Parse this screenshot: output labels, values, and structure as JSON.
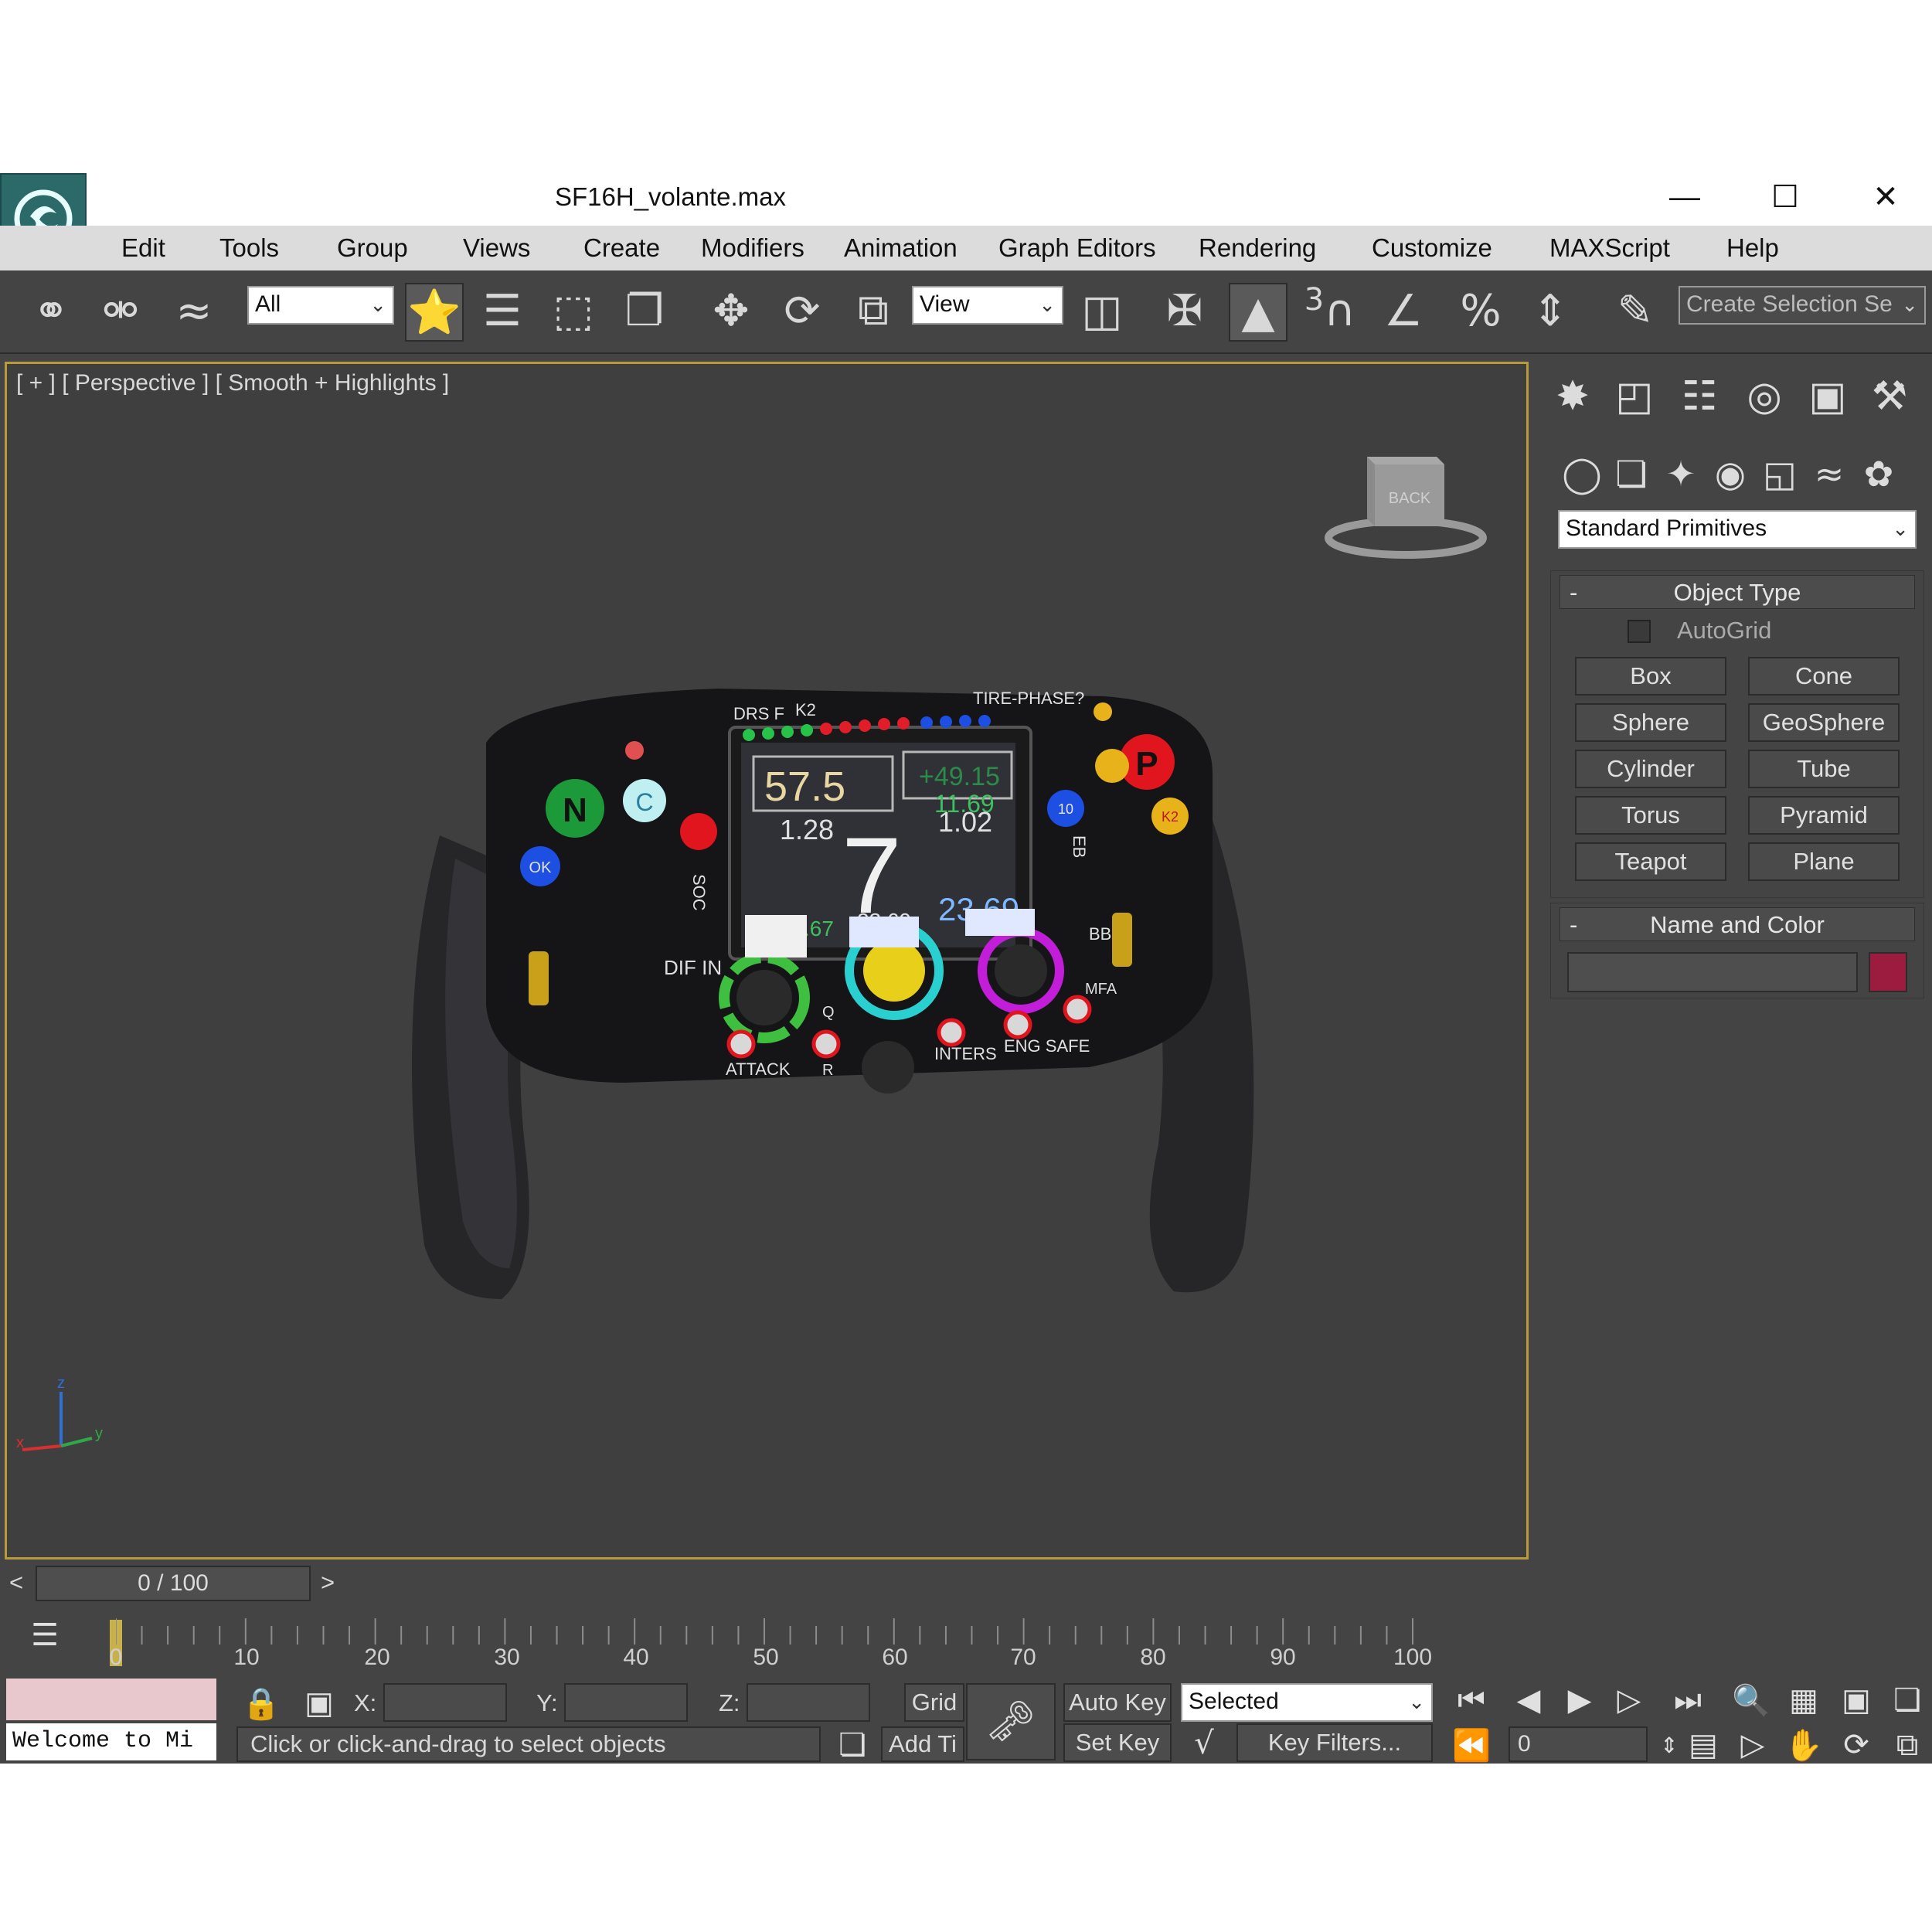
{
  "window": {
    "title": "SF16H_volante.max"
  },
  "menu": [
    "Edit",
    "Tools",
    "Group",
    "Views",
    "Create",
    "Modifiers",
    "Animation",
    "Graph Editors",
    "Rendering",
    "Customize",
    "MAXScript",
    "Help"
  ],
  "toolbar": {
    "filter_value": "All",
    "refcoord_value": "View",
    "snap_label": "3",
    "selection_set_placeholder": "Create Selection Se"
  },
  "viewport": {
    "label": "[ + ] [ Perspective ] [ Smooth + Highlights ]",
    "viewcube_face": "BACK",
    "axis": {
      "x": "x",
      "y": "y",
      "z": "z"
    },
    "model": {
      "dash": {
        "speed": "57.5",
        "delta": "+49.15",
        "value_a": "1.28",
        "value_b": "11.69",
        "value_c": "1.02",
        "gear": "7",
        "lap_time": "02:11.67",
        "small_time": "23.69",
        "big_time": "23.69"
      },
      "labels": {
        "drs": "DRS F",
        "k2_top": "K2",
        "tire_phase": "TIRE-PHASE?",
        "soc": "SOC",
        "eb": "EB",
        "dif_in": "DIF IN",
        "eng": "ENG",
        "bb": "BB",
        "attack": "ATTACK",
        "q": "Q",
        "r": "R",
        "inters": "INTERS",
        "eng_safe": "ENG SAFE",
        "mfa": "MFA",
        "btn_n": "N",
        "btn_c": "C",
        "btn_p": "P",
        "btn_ok": "OK",
        "btn_k2": "K2",
        "btn_10": "10"
      }
    }
  },
  "command_panel": {
    "category_value": "Standard Primitives",
    "object_type_title": "Object Type",
    "autogrid_label": "AutoGrid",
    "autogrid_checked": false,
    "buttons": [
      "Box",
      "Cone",
      "Sphere",
      "GeoSphere",
      "Cylinder",
      "Tube",
      "Torus",
      "Pyramid",
      "Teapot",
      "Plane"
    ],
    "name_color_title": "Name and Color",
    "object_color": "#9b1c3e"
  },
  "timeline": {
    "frame_text": "0 / 100",
    "prev": "<",
    "next": ">",
    "ticks": [
      "0",
      "10",
      "20",
      "30",
      "40",
      "50",
      "60",
      "70",
      "80",
      "90",
      "100"
    ]
  },
  "status": {
    "welcome": "Welcome to Mi",
    "x_label": "X:",
    "y_label": "Y:",
    "z_label": "Z:",
    "grid_label": "Grid",
    "prompt": "Click or click-and-drag to select objects",
    "add_time_tag": "Add Ti",
    "auto_key": "Auto Key",
    "set_key": "Set Key",
    "key_mode_value": "Selected",
    "key_filters": "Key Filters...",
    "current_frame": "0"
  }
}
